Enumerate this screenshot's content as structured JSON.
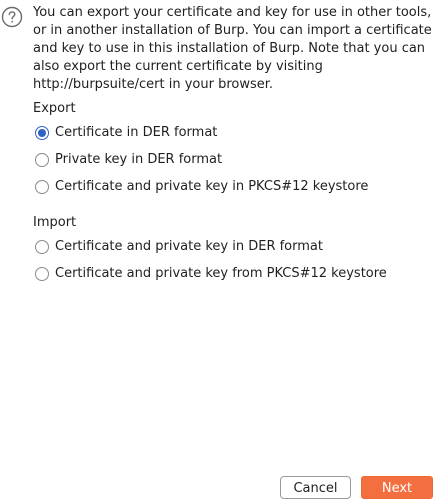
{
  "intro_text": "You can export your certificate and key for use in other tools, or in another installation of Burp. You can import a certificate and key to use in this installation of Burp. Note that you can also export the current certificate by visiting http://burpsuite/cert in your browser.",
  "export": {
    "title": "Export",
    "options": [
      {
        "label": "Certificate in DER format",
        "selected": true
      },
      {
        "label": "Private key in DER format",
        "selected": false
      },
      {
        "label": "Certificate and private key in PKCS#12 keystore",
        "selected": false
      }
    ]
  },
  "import": {
    "title": "Import",
    "options": [
      {
        "label": "Certificate and private key in DER format",
        "selected": false
      },
      {
        "label": "Certificate and private key from PKCS#12 keystore",
        "selected": false
      }
    ]
  },
  "buttons": {
    "cancel_label": "Cancel",
    "next_label": "Next"
  },
  "colors": {
    "accent": "#2f62c2",
    "primary_button": "#f36f3f"
  },
  "icons": {
    "help": "question-circle-icon"
  }
}
